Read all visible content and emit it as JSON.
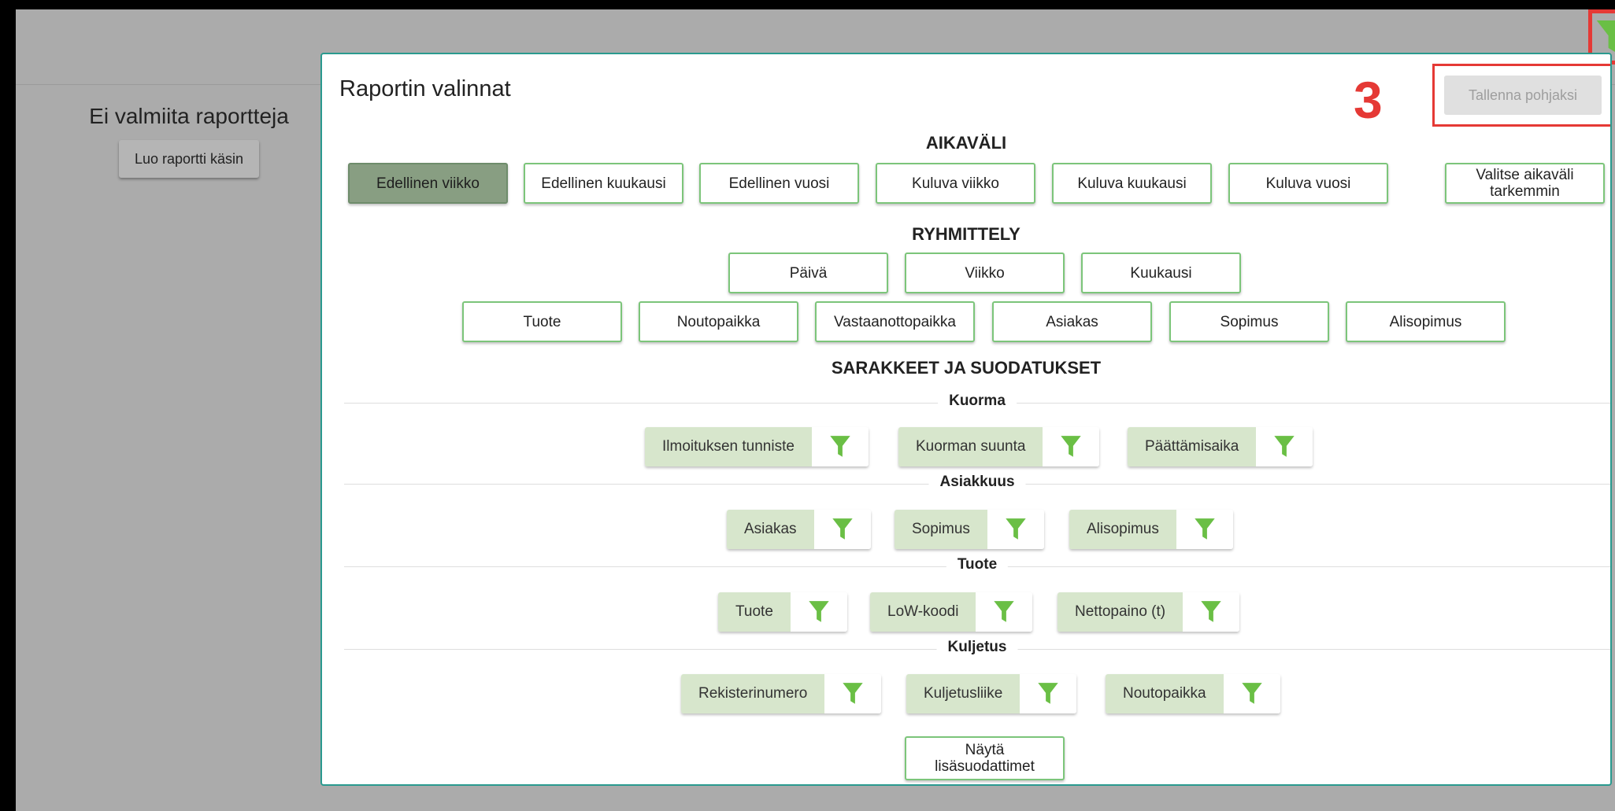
{
  "sidebar": {
    "title": "Ei valmiita raportteja",
    "create_button": "Luo raportti käsin"
  },
  "annotation": {
    "step": "3"
  },
  "dialog": {
    "title": "Raportin valinnat",
    "save_template": "Tallenna pohjaksi",
    "sections": {
      "time_range": "AIKAVÄLI",
      "grouping": "RYHMITTELY",
      "columns": "SARAKKEET JA SUODATUKSET"
    },
    "time_options": [
      "Edellinen viikko",
      "Edellinen kuukausi",
      "Edellinen vuosi",
      "Kuluva viikko",
      "Kuluva kuukausi",
      "Kuluva vuosi",
      "Valitse aikaväli tarkemmin"
    ],
    "selected_time_option": "Edellinen viikko",
    "grouping_time": [
      "Päivä",
      "Viikko",
      "Kuukausi"
    ],
    "grouping_fields": [
      "Tuote",
      "Noutopaikka",
      "Vastaanottopaikka",
      "Asiakas",
      "Sopimus",
      "Alisopimus"
    ],
    "column_groups": [
      {
        "name": "Kuorma",
        "columns": [
          "Ilmoituksen tunniste",
          "Kuorman suunta",
          "Päättämisaika"
        ]
      },
      {
        "name": "Asiakkuus",
        "columns": [
          "Asiakas",
          "Sopimus",
          "Alisopimus"
        ]
      },
      {
        "name": "Tuote",
        "columns": [
          "Tuote",
          "LoW-koodi",
          "Nettopaino (t)"
        ]
      },
      {
        "name": "Kuljetus",
        "columns": [
          "Rekisterinumero",
          "Kuljetusliike",
          "Noutopaikka"
        ]
      }
    ],
    "more_filters": "Näytä lisäsuodattimet"
  },
  "colors": {
    "accent_green": "#6abf45",
    "annotation_red": "#e53935",
    "dialog_border": "#2a9a8f",
    "chip_bg": "#d7e6cc",
    "selected_bg": "#889e82"
  }
}
